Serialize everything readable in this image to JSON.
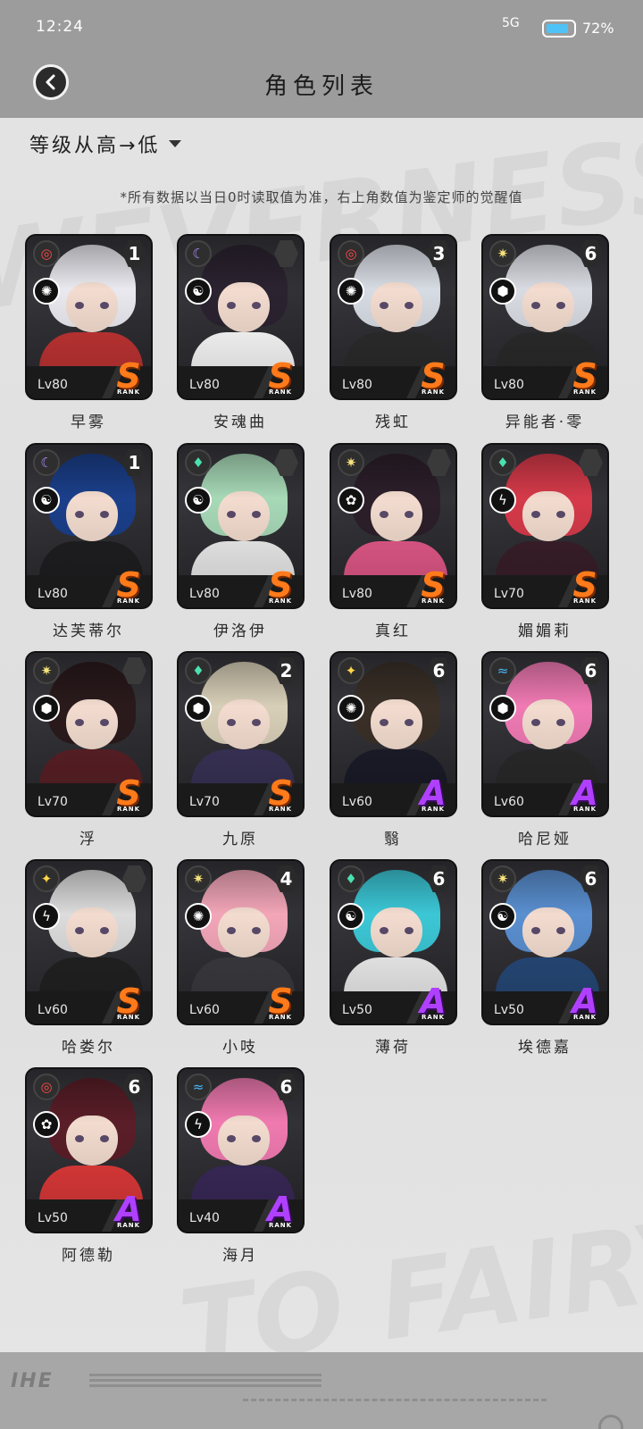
{
  "status_bar": {
    "time": "12:24",
    "signal": "5G",
    "battery": "72%"
  },
  "header": {
    "title": "角色列表",
    "back_icon": "back-arrow-icon"
  },
  "sort": {
    "label": "等级从高→低"
  },
  "note": "*所有数据以当日0时读取值为准，右上角数值为鉴定师的觉醒值",
  "rank_caption": "RANK",
  "characters": [
    {
      "name": "早雾",
      "level": "Lv80",
      "rank": "S",
      "awaken": "1",
      "element": "red",
      "hair": "#e9e9ef",
      "body": "#c23434"
    },
    {
      "name": "安魂曲",
      "level": "Lv80",
      "rank": "S",
      "awaken": "",
      "element": "purple",
      "hair": "#2b2330",
      "body": "#ffffff"
    },
    {
      "name": "残虹",
      "level": "Lv80",
      "rank": "S",
      "awaken": "3",
      "element": "red",
      "hair": "#d7dbe3",
      "body": "#2c2c2c"
    },
    {
      "name": "异能者·零",
      "level": "Lv80",
      "rank": "S",
      "awaken": "6",
      "element": "yellow",
      "hair": "#d9dbe2",
      "body": "#2b2b2b"
    },
    {
      "name": "达芙蒂尔",
      "level": "Lv80",
      "rank": "S",
      "awaken": "1",
      "element": "purple",
      "hair": "#1b3f8a",
      "body": "#1f1f22"
    },
    {
      "name": "伊洛伊",
      "level": "Lv80",
      "rank": "S",
      "awaken": "",
      "element": "green",
      "hair": "#a7d9b7",
      "body": "#f0f0f0"
    },
    {
      "name": "真红",
      "level": "Lv80",
      "rank": "S",
      "awaken": "",
      "element": "yellow",
      "hair": "#2c1f2a",
      "body": "#e55a8a"
    },
    {
      "name": "媚媚莉",
      "level": "Lv70",
      "rank": "S",
      "awaken": "",
      "element": "green",
      "hair": "#d63a4a",
      "body": "#3a1f2a"
    },
    {
      "name": "浮",
      "level": "Lv70",
      "rank": "S",
      "awaken": "",
      "element": "yellow",
      "hair": "#2a1a1c",
      "body": "#5a2026"
    },
    {
      "name": "九原",
      "level": "Lv70",
      "rank": "S",
      "awaken": "2",
      "element": "green",
      "hair": "#d8cfb8",
      "body": "#3a3358"
    },
    {
      "name": "翳",
      "level": "Lv60",
      "rank": "A",
      "awaken": "6",
      "element": "gold",
      "hair": "#3a3028",
      "body": "#1c1c2a"
    },
    {
      "name": "哈尼娅",
      "level": "Lv60",
      "rank": "A",
      "awaken": "6",
      "element": "blue",
      "hair": "#f07ab4",
      "body": "#2a2a2a"
    },
    {
      "name": "哈娄尔",
      "level": "Lv60",
      "rank": "S",
      "awaken": "",
      "element": "gold",
      "hair": "#dcdcdc",
      "body": "#222222"
    },
    {
      "name": "小吱",
      "level": "Lv60",
      "rank": "S",
      "awaken": "4",
      "element": "yellow",
      "hair": "#f2a6b8",
      "body": "#3b3b40"
    },
    {
      "name": "薄荷",
      "level": "Lv50",
      "rank": "A",
      "awaken": "6",
      "element": "green",
      "hair": "#3cc7d6",
      "body": "#f2f2f2"
    },
    {
      "name": "埃德嘉",
      "level": "Lv50",
      "rank": "A",
      "awaken": "6",
      "element": "yellow",
      "hair": "#5a8fd0",
      "body": "#274a7a"
    },
    {
      "name": "阿德勒",
      "level": "Lv50",
      "rank": "A",
      "awaken": "6",
      "element": "red",
      "hair": "#5a1e28",
      "body": "#e23a3a"
    },
    {
      "name": "海月",
      "level": "Lv40",
      "rank": "A",
      "awaken": "6",
      "element": "blue",
      "hair": "#f07ab0",
      "body": "#3a2a5a"
    }
  ]
}
